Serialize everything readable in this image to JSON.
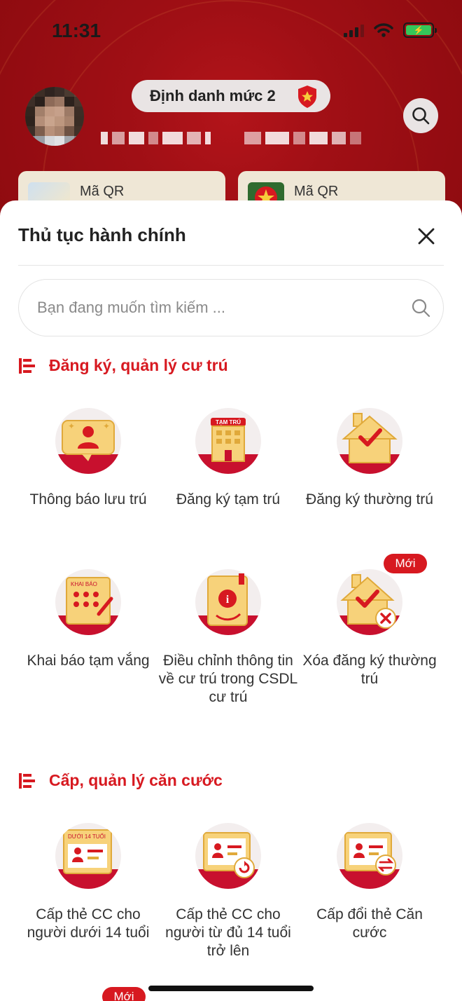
{
  "status_bar": {
    "time": "11:31"
  },
  "header": {
    "level_badge": "Định danh mức 2",
    "qr_cards": [
      {
        "label": "Mã QR"
      },
      {
        "label": "Mã QR"
      }
    ]
  },
  "sheet": {
    "title": "Thủ tục hành chính",
    "search_placeholder": "Bạn đang muốn tìm kiếm ...",
    "sections": [
      {
        "title": "Đăng ký, quản lý cư trú",
        "items": [
          {
            "label": "Thông báo lưu trú",
            "icon": "notice-stay-icon",
            "is_new": false
          },
          {
            "label": "Đăng ký tạm trú",
            "icon": "temporary-residence-icon",
            "tag": "TẠM TRÚ",
            "is_new": false
          },
          {
            "label": "Đăng ký thường trú",
            "icon": "permanent-residence-icon",
            "is_new": false
          },
          {
            "label": "Khai báo tạm vắng",
            "icon": "temporary-absence-icon",
            "tag": "KHAI BÁO",
            "is_new": false
          },
          {
            "label": "Điều chỉnh thông tin về cư trú trong CSDL cư trú",
            "icon": "adjust-info-icon",
            "is_new": false
          },
          {
            "label": "Xóa đăng ký thường trú",
            "icon": "delete-residence-icon",
            "is_new": true
          }
        ]
      },
      {
        "title": "Cấp, quản lý căn cước",
        "items": [
          {
            "label": "Cấp thẻ CC cho người dưới 14 tuổi",
            "icon": "id-card-under14-icon",
            "tag": "DƯỚI 14 TUỔI",
            "is_new": false
          },
          {
            "label": "Cấp thẻ CC cho người từ đủ 14 tuổi trở lên",
            "icon": "id-card-renew-icon",
            "is_new": false
          },
          {
            "label": "Cấp đổi thẻ Căn cước",
            "icon": "id-card-exchange-icon",
            "is_new": false
          }
        ]
      }
    ],
    "new_badge": "Mới"
  },
  "colors": {
    "brand_red": "#d71920",
    "header_red": "#a00f15",
    "icon_gold": "#f2c14e"
  }
}
